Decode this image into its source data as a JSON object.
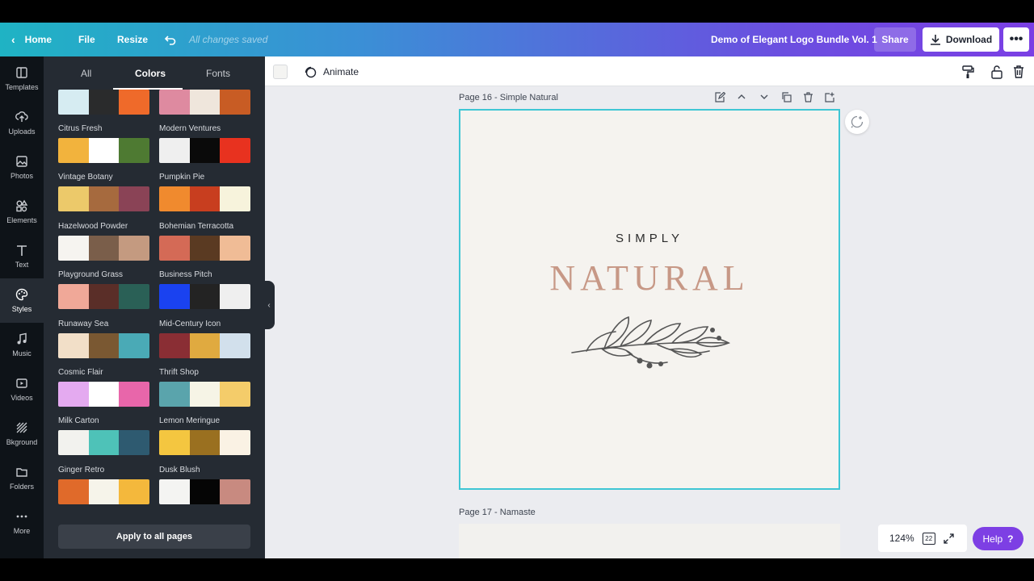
{
  "topbar": {
    "home": "Home",
    "file": "File",
    "resize": "Resize",
    "save_status": "All changes saved",
    "doc_title": "Demo of Elegant Logo Bundle Vol. 1",
    "share": "Share",
    "download": "Download"
  },
  "leftnav": [
    {
      "label": "Templates",
      "icon": "templates-icon"
    },
    {
      "label": "Uploads",
      "icon": "upload-icon"
    },
    {
      "label": "Photos",
      "icon": "photo-icon"
    },
    {
      "label": "Elements",
      "icon": "elements-icon"
    },
    {
      "label": "Text",
      "icon": "text-icon"
    },
    {
      "label": "Styles",
      "icon": "palette-icon",
      "active": true
    },
    {
      "label": "Music",
      "icon": "music-icon"
    },
    {
      "label": "Videos",
      "icon": "video-icon"
    },
    {
      "label": "Bkground",
      "icon": "background-icon"
    },
    {
      "label": "Folders",
      "icon": "folder-icon"
    },
    {
      "label": "More",
      "icon": "more-icon"
    }
  ],
  "panel": {
    "tabs": [
      "All",
      "Colors",
      "Fonts"
    ],
    "active_tab": "Colors",
    "partial_palettes": [
      [
        "#d6ecf2",
        "#2a2b2c",
        "#ef6a2a"
      ],
      [
        "#de8aa0",
        "#efe6dc",
        "#c85c24"
      ]
    ],
    "palettes": [
      {
        "name": "Citrus Fresh",
        "colors": [
          "#f2b33d",
          "#ffffff",
          "#4e7a32"
        ]
      },
      {
        "name": "Modern Ventures",
        "colors": [
          "#efefef",
          "#0a0a0a",
          "#e8321f"
        ]
      },
      {
        "name": "Vintage Botany",
        "colors": [
          "#ecc96a",
          "#a66a3e",
          "#8a4356"
        ]
      },
      {
        "name": "Pumpkin Pie",
        "colors": [
          "#f08a2e",
          "#c83e1f",
          "#f7f3dc"
        ]
      },
      {
        "name": "Hazelwood Powder",
        "colors": [
          "#f6f4f0",
          "#7a5e4a",
          "#c49a80"
        ]
      },
      {
        "name": "Bohemian Terracotta",
        "colors": [
          "#d46a56",
          "#5a3a22",
          "#f0bc96"
        ]
      },
      {
        "name": "Playground Grass",
        "colors": [
          "#f0a898",
          "#5a2e28",
          "#2a6056"
        ]
      },
      {
        "name": "Business Pitch",
        "colors": [
          "#1a42f0",
          "#232323",
          "#efefef"
        ]
      },
      {
        "name": "Runaway Sea",
        "colors": [
          "#f2dfc8",
          "#7a5832",
          "#4aaab6"
        ]
      },
      {
        "name": "Mid-Century Icon",
        "colors": [
          "#8a2e34",
          "#e0aa40",
          "#d2e0ec"
        ]
      },
      {
        "name": "Cosmic Flair",
        "colors": [
          "#e4aaf0",
          "#ffffff",
          "#e866aa"
        ]
      },
      {
        "name": "Thrift Shop",
        "colors": [
          "#5aa4ac",
          "#f6f4e6",
          "#f4cc6a"
        ]
      },
      {
        "name": "Milk Carton",
        "colors": [
          "#f2f2ee",
          "#4ec2b8",
          "#2e5a70"
        ]
      },
      {
        "name": "Lemon Meringue",
        "colors": [
          "#f4c640",
          "#9a7020",
          "#faf2e4"
        ]
      },
      {
        "name": "Ginger Retro",
        "colors": [
          "#e06a2a",
          "#f6f4ea",
          "#f4b83c"
        ]
      },
      {
        "name": "Dusk Blush",
        "colors": [
          "#f4f4f2",
          "#050505",
          "#c88a80"
        ]
      }
    ],
    "apply_label": "Apply to all pages"
  },
  "toolbar": {
    "animate": "Animate"
  },
  "canvas": {
    "page16_label": "Page 16 - Simple Natural",
    "page17_label": "Page 17 - Namaste",
    "logo_line1": "SIMPLY",
    "logo_line2": "NATURAL"
  },
  "footer": {
    "zoom": "124%",
    "page_count": "22",
    "help": "Help"
  },
  "colors": {
    "selection_border": "#3fc6d4",
    "accent_purple": "#7d3fe4",
    "natural_text": "#c79886"
  }
}
